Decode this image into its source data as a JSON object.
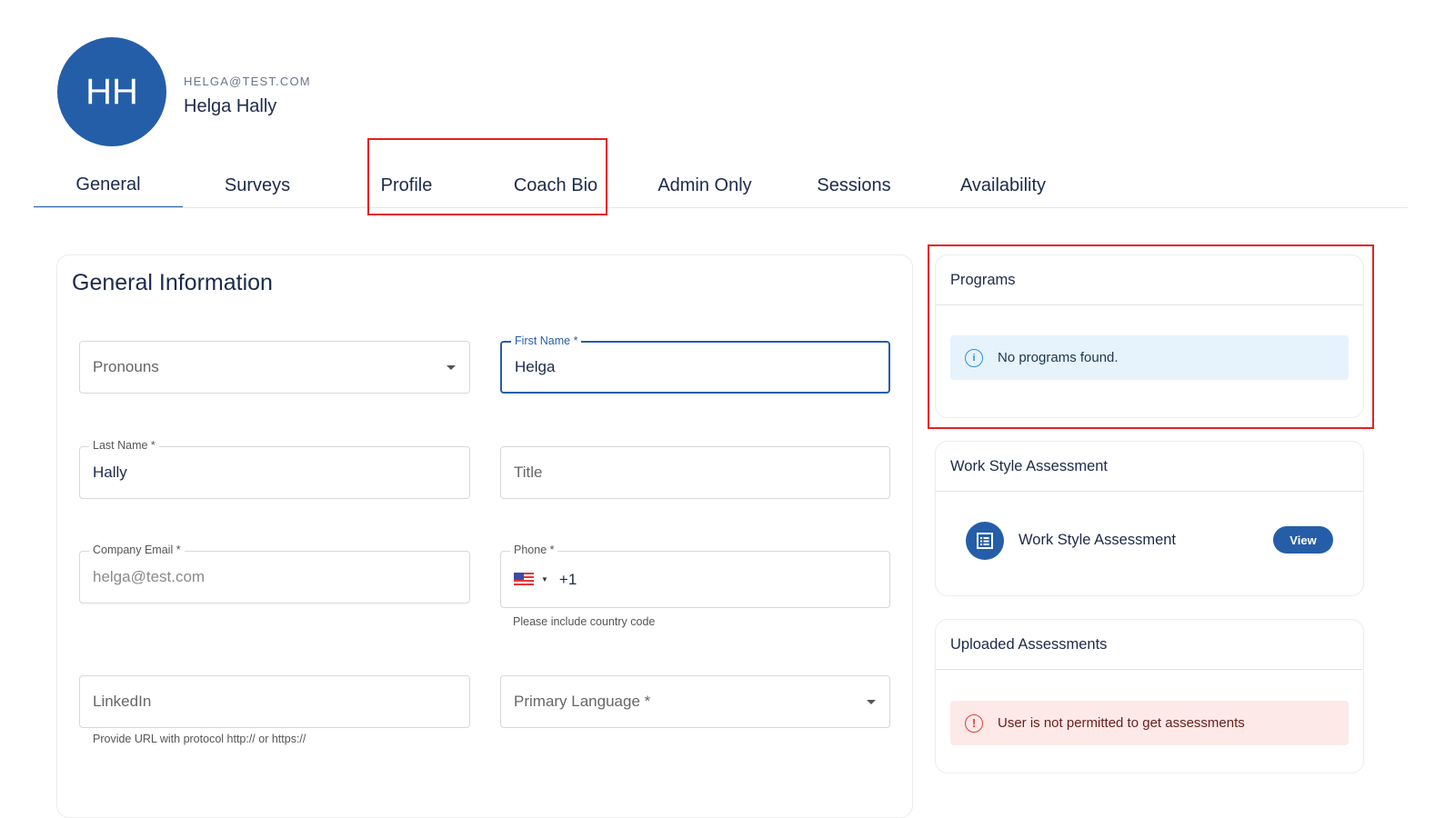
{
  "user": {
    "initials": "HH",
    "email": "HELGA@TEST.COM",
    "name": "Helga Hally"
  },
  "tabs": [
    "General",
    "Surveys",
    "Profile",
    "Coach Bio",
    "Admin Only",
    "Sessions",
    "Availability"
  ],
  "general": {
    "title": "General Information",
    "pronouns": {
      "placeholder": "Pronouns"
    },
    "first_name": {
      "label": "First Name *",
      "value": "Helga"
    },
    "last_name": {
      "label": "Last Name *",
      "value": "Hally"
    },
    "title_field": {
      "placeholder": "Title"
    },
    "company_email": {
      "label": "Company Email *",
      "value": "helga@test.com"
    },
    "phone": {
      "label": "Phone *",
      "value": "+1",
      "helper": "Please include country code"
    },
    "linkedin": {
      "placeholder": "LinkedIn",
      "helper": "Provide URL with protocol http:// or https://"
    },
    "primary_language": {
      "placeholder": "Primary Language *"
    }
  },
  "programs": {
    "title": "Programs",
    "message": "No programs found."
  },
  "work_style": {
    "title": "Work Style Assessment",
    "item": "Work Style Assessment",
    "button": "View"
  },
  "uploaded": {
    "title": "Uploaded Assessments",
    "message": "User is not permitted to get assessments"
  },
  "colors": {
    "primary": "#255ea8",
    "highlight": "#e5201f"
  }
}
